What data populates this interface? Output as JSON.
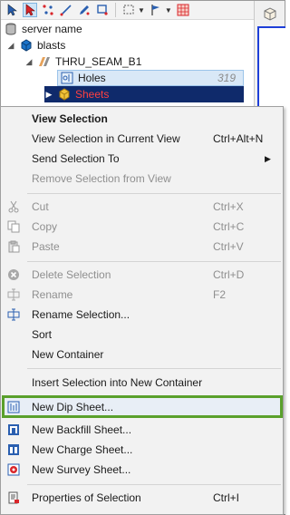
{
  "toolbar": {
    "buttons": [
      "select-icon",
      "pointer-icon",
      "points-icon",
      "line-icon",
      "pen-icon",
      "box-icon",
      "marquee-icon",
      "dropdown-icon",
      "flag-icon",
      "grid-icon"
    ]
  },
  "tree": {
    "items": [
      {
        "label": "server name",
        "icon": "server-icon"
      },
      {
        "label": "blasts",
        "icon": "cube-icon"
      },
      {
        "label": "THRU_SEAM_B1",
        "icon": "seam-icon"
      },
      {
        "label": "Holes",
        "icon": "holes-icon",
        "count": "319"
      },
      {
        "label": "Sheets",
        "icon": "sheets-icon"
      }
    ]
  },
  "menu": {
    "items": [
      {
        "label": "View Selection",
        "shortcut": "",
        "bold": true,
        "disabled": false,
        "icon": ""
      },
      {
        "label": "View Selection in Current View",
        "shortcut": "Ctrl+Alt+N",
        "disabled": false,
        "icon": ""
      },
      {
        "label": "Send Selection To",
        "shortcut": "",
        "submenu": true,
        "disabled": false,
        "icon": ""
      },
      {
        "label": "Remove Selection from View",
        "shortcut": "",
        "disabled": true,
        "icon": ""
      },
      {
        "label": "Cut",
        "shortcut": "Ctrl+X",
        "disabled": true,
        "icon": "scissors-icon"
      },
      {
        "label": "Copy",
        "shortcut": "Ctrl+C",
        "disabled": true,
        "icon": "copy-icon"
      },
      {
        "label": "Paste",
        "shortcut": "Ctrl+V",
        "disabled": true,
        "icon": "paste-icon"
      },
      {
        "label": "Delete Selection",
        "shortcut": "Ctrl+D",
        "disabled": true,
        "icon": "delete-icon"
      },
      {
        "label": "Rename",
        "shortcut": "F2",
        "disabled": true,
        "icon": "rename-icon"
      },
      {
        "label": "Rename Selection...",
        "shortcut": "",
        "disabled": false,
        "icon": "rename-selection-icon"
      },
      {
        "label": "Sort",
        "shortcut": "",
        "disabled": false,
        "icon": ""
      },
      {
        "label": "New Container",
        "shortcut": "",
        "disabled": false,
        "icon": ""
      },
      {
        "label": "Insert Selection into New Container",
        "shortcut": "",
        "disabled": false,
        "icon": ""
      },
      {
        "label": "New Dip Sheet...",
        "shortcut": "",
        "disabled": false,
        "icon": "dip-sheet-icon",
        "highlighted": true
      },
      {
        "label": "New Backfill Sheet...",
        "shortcut": "",
        "disabled": false,
        "icon": "backfill-sheet-icon"
      },
      {
        "label": "New Charge Sheet...",
        "shortcut": "",
        "disabled": false,
        "icon": "charge-sheet-icon"
      },
      {
        "label": "New Survey Sheet...",
        "shortcut": "",
        "disabled": false,
        "icon": "survey-sheet-icon"
      },
      {
        "label": "Properties of Selection",
        "shortcut": "Ctrl+I",
        "disabled": false,
        "icon": "properties-icon"
      }
    ],
    "submenu_arrow": "▶"
  },
  "colors": {
    "highlight_border": "#5aa02c",
    "selection_bg": "#0f2a6b",
    "selection_text": "#ff4040",
    "viewport_border": "#1e3fd8"
  }
}
